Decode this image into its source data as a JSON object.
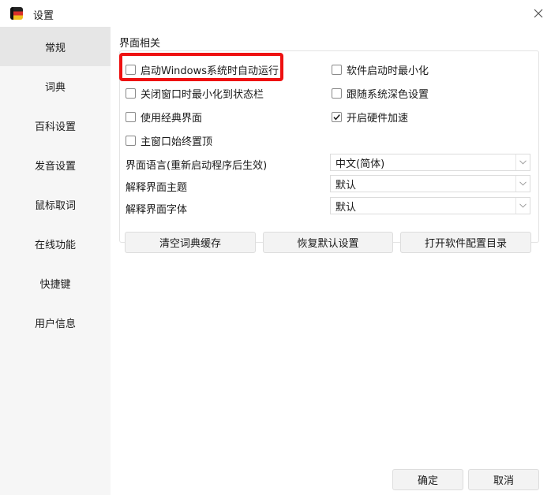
{
  "window": {
    "title": "设置",
    "icon": "app-flag-icon",
    "close_icon": "close-icon"
  },
  "sidebar": {
    "items": [
      {
        "label": "常规",
        "active": true
      },
      {
        "label": "词典",
        "active": false
      },
      {
        "label": "百科设置",
        "active": false
      },
      {
        "label": "发音设置",
        "active": false
      },
      {
        "label": "鼠标取词",
        "active": false
      },
      {
        "label": "在线功能",
        "active": false
      },
      {
        "label": "快捷键",
        "active": false
      },
      {
        "label": "用户信息",
        "active": false
      }
    ]
  },
  "main": {
    "section_title": "界面相关",
    "checkboxes": [
      {
        "label": "启动Windows系统时自动运行",
        "checked": false
      },
      {
        "label": "软件启动时最小化",
        "checked": false
      },
      {
        "label": "关闭窗口时最小化到状态栏",
        "checked": false
      },
      {
        "label": "跟随系统深色设置",
        "checked": false
      },
      {
        "label": "使用经典界面",
        "checked": false
      },
      {
        "label": "开启硬件加速",
        "checked": true
      },
      {
        "label": "主窗口始终置顶",
        "checked": false
      }
    ],
    "selects": [
      {
        "label": "界面语言(重新启动程序后生效)",
        "value": "中文(简体)"
      },
      {
        "label": "解释界面主题",
        "value": "默认"
      },
      {
        "label": "解释界面字体",
        "value": "默认"
      }
    ],
    "actions": {
      "clear_cache": "清空词典缓存",
      "restore_defaults": "恢复默认设置",
      "open_config_dir": "打开软件配置目录"
    }
  },
  "footer": {
    "ok": "确定",
    "cancel": "取消"
  },
  "colors": {
    "highlight": "#ee1111",
    "sidebar_bg": "#f6f6f6",
    "sidebar_active": "#e6e6e6",
    "button_bg": "#f3f3f3"
  }
}
